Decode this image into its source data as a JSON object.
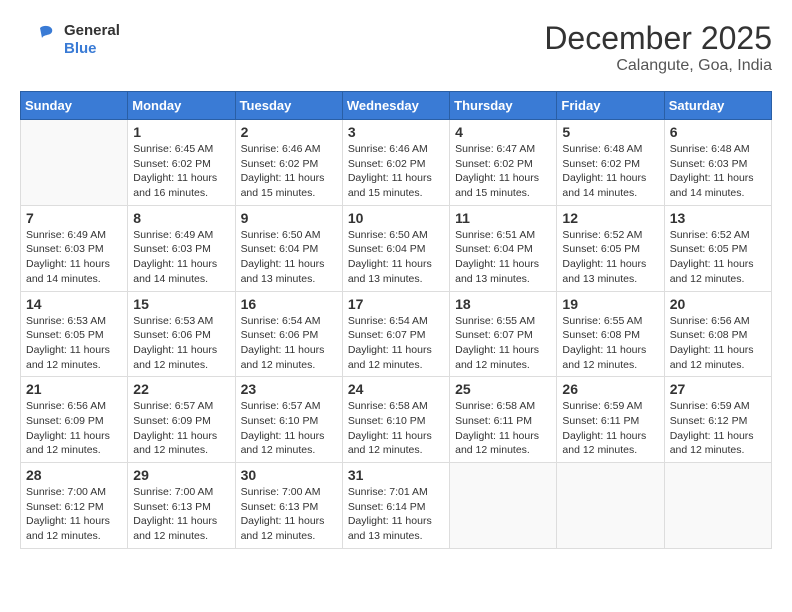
{
  "header": {
    "logo_general": "General",
    "logo_blue": "Blue",
    "month_title": "December 2025",
    "location": "Calangute, Goa, India"
  },
  "calendar": {
    "days_of_week": [
      "Sunday",
      "Monday",
      "Tuesday",
      "Wednesday",
      "Thursday",
      "Friday",
      "Saturday"
    ],
    "weeks": [
      [
        {
          "day": "",
          "info": ""
        },
        {
          "day": "1",
          "info": "Sunrise: 6:45 AM\nSunset: 6:02 PM\nDaylight: 11 hours and 16 minutes."
        },
        {
          "day": "2",
          "info": "Sunrise: 6:46 AM\nSunset: 6:02 PM\nDaylight: 11 hours and 15 minutes."
        },
        {
          "day": "3",
          "info": "Sunrise: 6:46 AM\nSunset: 6:02 PM\nDaylight: 11 hours and 15 minutes."
        },
        {
          "day": "4",
          "info": "Sunrise: 6:47 AM\nSunset: 6:02 PM\nDaylight: 11 hours and 15 minutes."
        },
        {
          "day": "5",
          "info": "Sunrise: 6:48 AM\nSunset: 6:02 PM\nDaylight: 11 hours and 14 minutes."
        },
        {
          "day": "6",
          "info": "Sunrise: 6:48 AM\nSunset: 6:03 PM\nDaylight: 11 hours and 14 minutes."
        }
      ],
      [
        {
          "day": "7",
          "info": "Sunrise: 6:49 AM\nSunset: 6:03 PM\nDaylight: 11 hours and 14 minutes."
        },
        {
          "day": "8",
          "info": "Sunrise: 6:49 AM\nSunset: 6:03 PM\nDaylight: 11 hours and 14 minutes."
        },
        {
          "day": "9",
          "info": "Sunrise: 6:50 AM\nSunset: 6:04 PM\nDaylight: 11 hours and 13 minutes."
        },
        {
          "day": "10",
          "info": "Sunrise: 6:50 AM\nSunset: 6:04 PM\nDaylight: 11 hours and 13 minutes."
        },
        {
          "day": "11",
          "info": "Sunrise: 6:51 AM\nSunset: 6:04 PM\nDaylight: 11 hours and 13 minutes."
        },
        {
          "day": "12",
          "info": "Sunrise: 6:52 AM\nSunset: 6:05 PM\nDaylight: 11 hours and 13 minutes."
        },
        {
          "day": "13",
          "info": "Sunrise: 6:52 AM\nSunset: 6:05 PM\nDaylight: 11 hours and 12 minutes."
        }
      ],
      [
        {
          "day": "14",
          "info": "Sunrise: 6:53 AM\nSunset: 6:05 PM\nDaylight: 11 hours and 12 minutes."
        },
        {
          "day": "15",
          "info": "Sunrise: 6:53 AM\nSunset: 6:06 PM\nDaylight: 11 hours and 12 minutes."
        },
        {
          "day": "16",
          "info": "Sunrise: 6:54 AM\nSunset: 6:06 PM\nDaylight: 11 hours and 12 minutes."
        },
        {
          "day": "17",
          "info": "Sunrise: 6:54 AM\nSunset: 6:07 PM\nDaylight: 11 hours and 12 minutes."
        },
        {
          "day": "18",
          "info": "Sunrise: 6:55 AM\nSunset: 6:07 PM\nDaylight: 11 hours and 12 minutes."
        },
        {
          "day": "19",
          "info": "Sunrise: 6:55 AM\nSunset: 6:08 PM\nDaylight: 11 hours and 12 minutes."
        },
        {
          "day": "20",
          "info": "Sunrise: 6:56 AM\nSunset: 6:08 PM\nDaylight: 11 hours and 12 minutes."
        }
      ],
      [
        {
          "day": "21",
          "info": "Sunrise: 6:56 AM\nSunset: 6:09 PM\nDaylight: 11 hours and 12 minutes."
        },
        {
          "day": "22",
          "info": "Sunrise: 6:57 AM\nSunset: 6:09 PM\nDaylight: 11 hours and 12 minutes."
        },
        {
          "day": "23",
          "info": "Sunrise: 6:57 AM\nSunset: 6:10 PM\nDaylight: 11 hours and 12 minutes."
        },
        {
          "day": "24",
          "info": "Sunrise: 6:58 AM\nSunset: 6:10 PM\nDaylight: 11 hours and 12 minutes."
        },
        {
          "day": "25",
          "info": "Sunrise: 6:58 AM\nSunset: 6:11 PM\nDaylight: 11 hours and 12 minutes."
        },
        {
          "day": "26",
          "info": "Sunrise: 6:59 AM\nSunset: 6:11 PM\nDaylight: 11 hours and 12 minutes."
        },
        {
          "day": "27",
          "info": "Sunrise: 6:59 AM\nSunset: 6:12 PM\nDaylight: 11 hours and 12 minutes."
        }
      ],
      [
        {
          "day": "28",
          "info": "Sunrise: 7:00 AM\nSunset: 6:12 PM\nDaylight: 11 hours and 12 minutes."
        },
        {
          "day": "29",
          "info": "Sunrise: 7:00 AM\nSunset: 6:13 PM\nDaylight: 11 hours and 12 minutes."
        },
        {
          "day": "30",
          "info": "Sunrise: 7:00 AM\nSunset: 6:13 PM\nDaylight: 11 hours and 12 minutes."
        },
        {
          "day": "31",
          "info": "Sunrise: 7:01 AM\nSunset: 6:14 PM\nDaylight: 11 hours and 13 minutes."
        },
        {
          "day": "",
          "info": ""
        },
        {
          "day": "",
          "info": ""
        },
        {
          "day": "",
          "info": ""
        }
      ]
    ]
  }
}
